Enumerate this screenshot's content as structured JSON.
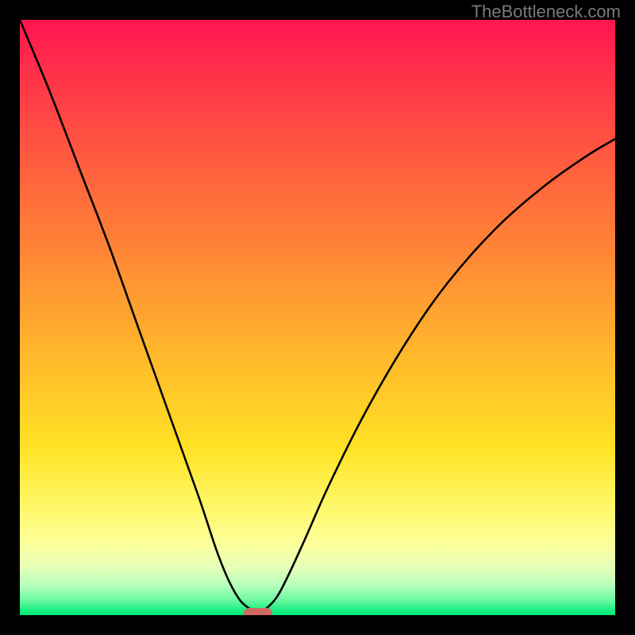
{
  "watermark": "TheBottleneck.com",
  "chart_data": {
    "type": "line",
    "title": "",
    "xlabel": "",
    "ylabel": "",
    "xlim": [
      0,
      100
    ],
    "ylim": [
      0,
      100
    ],
    "grid": false,
    "legend": false,
    "series": [
      {
        "name": "curve",
        "x": [
          0,
          5,
          10,
          15,
          20,
          25,
          30,
          33,
          35,
          37,
          39,
          40,
          41,
          43,
          45,
          48,
          52,
          58,
          65,
          72,
          80,
          88,
          95,
          100
        ],
        "values": [
          100,
          88,
          75,
          62,
          48,
          34,
          20,
          11,
          6,
          2.5,
          0.8,
          0.3,
          0.8,
          2.8,
          6.5,
          13,
          22,
          34,
          46,
          56,
          65,
          72,
          77,
          80
        ]
      }
    ],
    "marker": {
      "x": 40,
      "y": 0.3,
      "color": "#cf6a63"
    },
    "gradient_stops": [
      {
        "pos": 0,
        "color": "#ff1450"
      },
      {
        "pos": 0.08,
        "color": "#ff2e4a"
      },
      {
        "pos": 0.22,
        "color": "#ff5740"
      },
      {
        "pos": 0.38,
        "color": "#ff8336"
      },
      {
        "pos": 0.55,
        "color": "#ffb42c"
      },
      {
        "pos": 0.72,
        "color": "#ffe224"
      },
      {
        "pos": 0.82,
        "color": "#fff86a"
      },
      {
        "pos": 0.88,
        "color": "#fcff9b"
      },
      {
        "pos": 0.92,
        "color": "#e4ffb7"
      },
      {
        "pos": 0.95,
        "color": "#b7febc"
      },
      {
        "pos": 0.975,
        "color": "#6bf9a1"
      },
      {
        "pos": 0.99,
        "color": "#20ef84"
      },
      {
        "pos": 1.0,
        "color": "#00e873"
      }
    ]
  }
}
